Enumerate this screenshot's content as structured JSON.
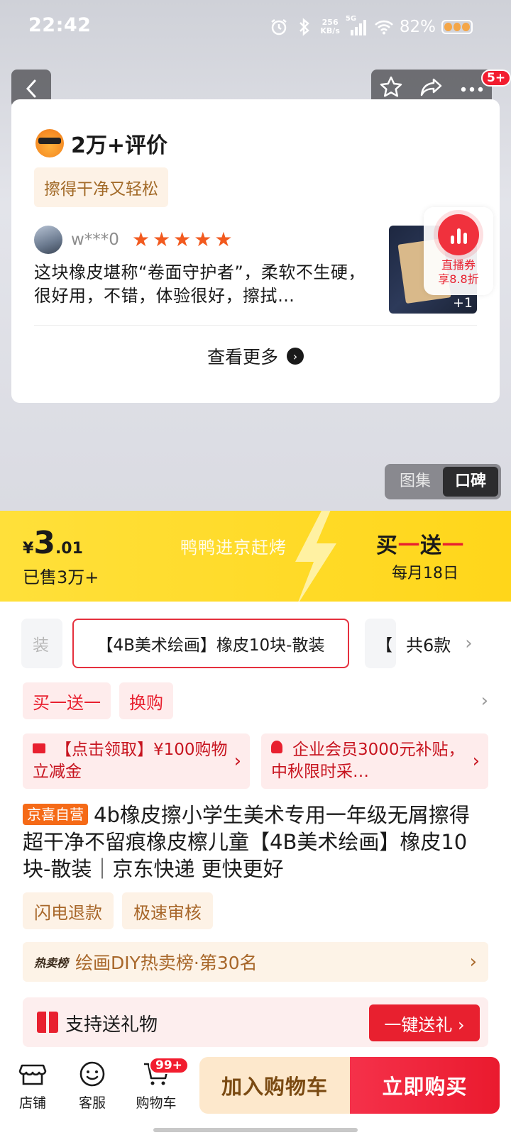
{
  "status_bar": {
    "time": "22:42",
    "net_speed_value": "256",
    "net_speed_unit": "KB/s",
    "signal_label": "5G",
    "battery_percent": "82%"
  },
  "header": {
    "message_badge": "5+"
  },
  "review": {
    "count_title": "2万+评价",
    "tag": "擦得干净又轻松",
    "reviewer_name": "w***0",
    "rating": 5,
    "text": "这块橡皮堪称“卷面守护者”，柔软不生硬，很好用，不错，体验很好，擦拭…",
    "image_more": "+1",
    "view_more": "查看更多"
  },
  "live_coupon": {
    "line1": "直播券",
    "line2": "享8.8折"
  },
  "view_toggle": {
    "options": [
      "图集",
      "口碑"
    ],
    "active_index": 1
  },
  "price_banner": {
    "currency": "¥",
    "price_int": "3",
    "price_dec": ".01",
    "sold": "已售3万+",
    "slogan": "鸭鸭进京赶烤",
    "promo_a": "买",
    "promo_b": "一",
    "promo_c": "送",
    "promo_d": "一",
    "promo_date": "每月18日",
    "colors": {
      "background": "#ffd61a",
      "accent": "#e8202f"
    }
  },
  "variants": {
    "prev_partial": "装",
    "selected": "【4B美术绘画】橡皮10块-散装",
    "next_partial": "【",
    "total": "共6款"
  },
  "promo_tags": [
    "买一送一",
    "换购"
  ],
  "coupons": [
    {
      "icon": "card-icon",
      "text": "【点击领取】¥100购物立减金"
    },
    {
      "icon": "person-icon",
      "text": "企业会员3000元补贴，中秋限时采…"
    }
  ],
  "product": {
    "badge": "京喜自营",
    "title": "4b橡皮擦小学生美术专用一年级无屑擦得超干净不留痕橡皮檫儿童【4B美术绘画】橡皮10块-散装｜京东快递 更快更好"
  },
  "service_tags": [
    "闪电退款",
    "极速审核"
  ],
  "rank": {
    "label": "热卖榜",
    "text": "绘画DIY热卖榜·第30名"
  },
  "gift": {
    "text": "支持送礼物",
    "button": "一键送礼 ›"
  },
  "bottom_bar": {
    "shop": "店铺",
    "service": "客服",
    "cart": "购物车",
    "cart_badge": "99+",
    "add_to_cart": "加入购物车",
    "buy_now": "立即购买"
  }
}
